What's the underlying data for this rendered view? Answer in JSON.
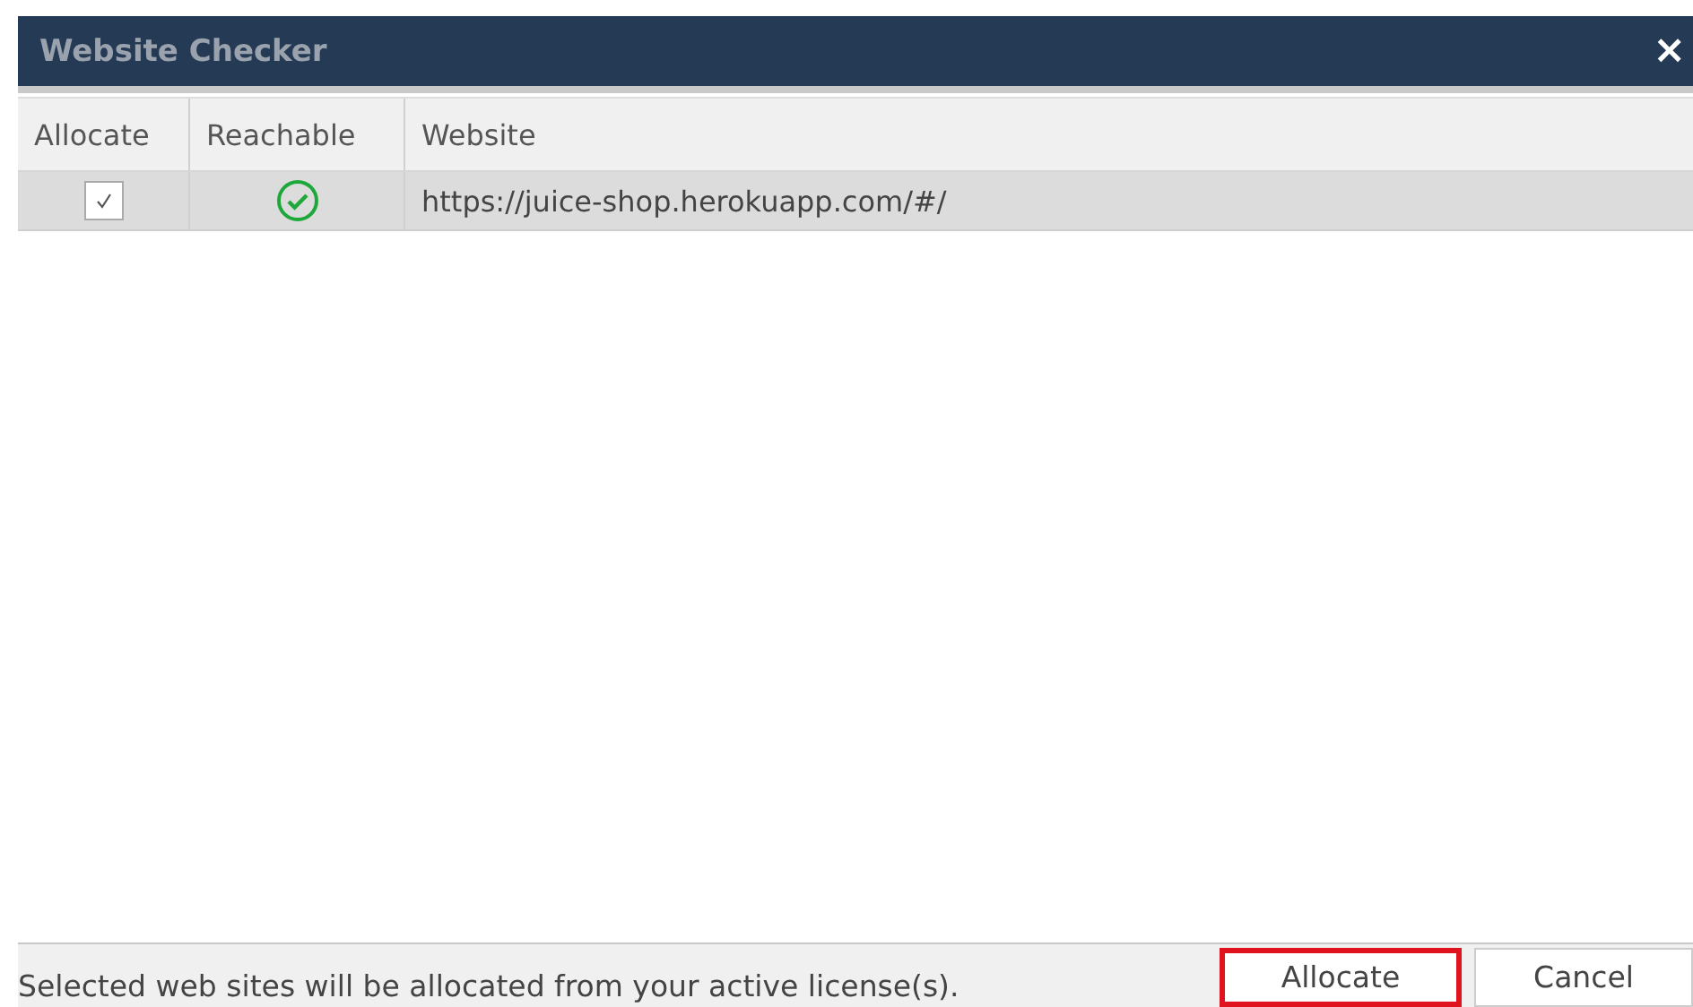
{
  "window": {
    "title": "Website Checker",
    "close": "×"
  },
  "table": {
    "columns": [
      "Allocate",
      "Reachable",
      "Website"
    ],
    "rows": [
      {
        "allocate": true,
        "reachable": true,
        "website": "https://juice-shop.herokuapp.com/#/"
      }
    ]
  },
  "footer": {
    "message": "Selected web sites will be allocated from your active license(s).",
    "buttons": [
      {
        "label": "Allocate",
        "highlighted": true
      },
      {
        "label": "Cancel",
        "highlighted": false
      }
    ]
  }
}
